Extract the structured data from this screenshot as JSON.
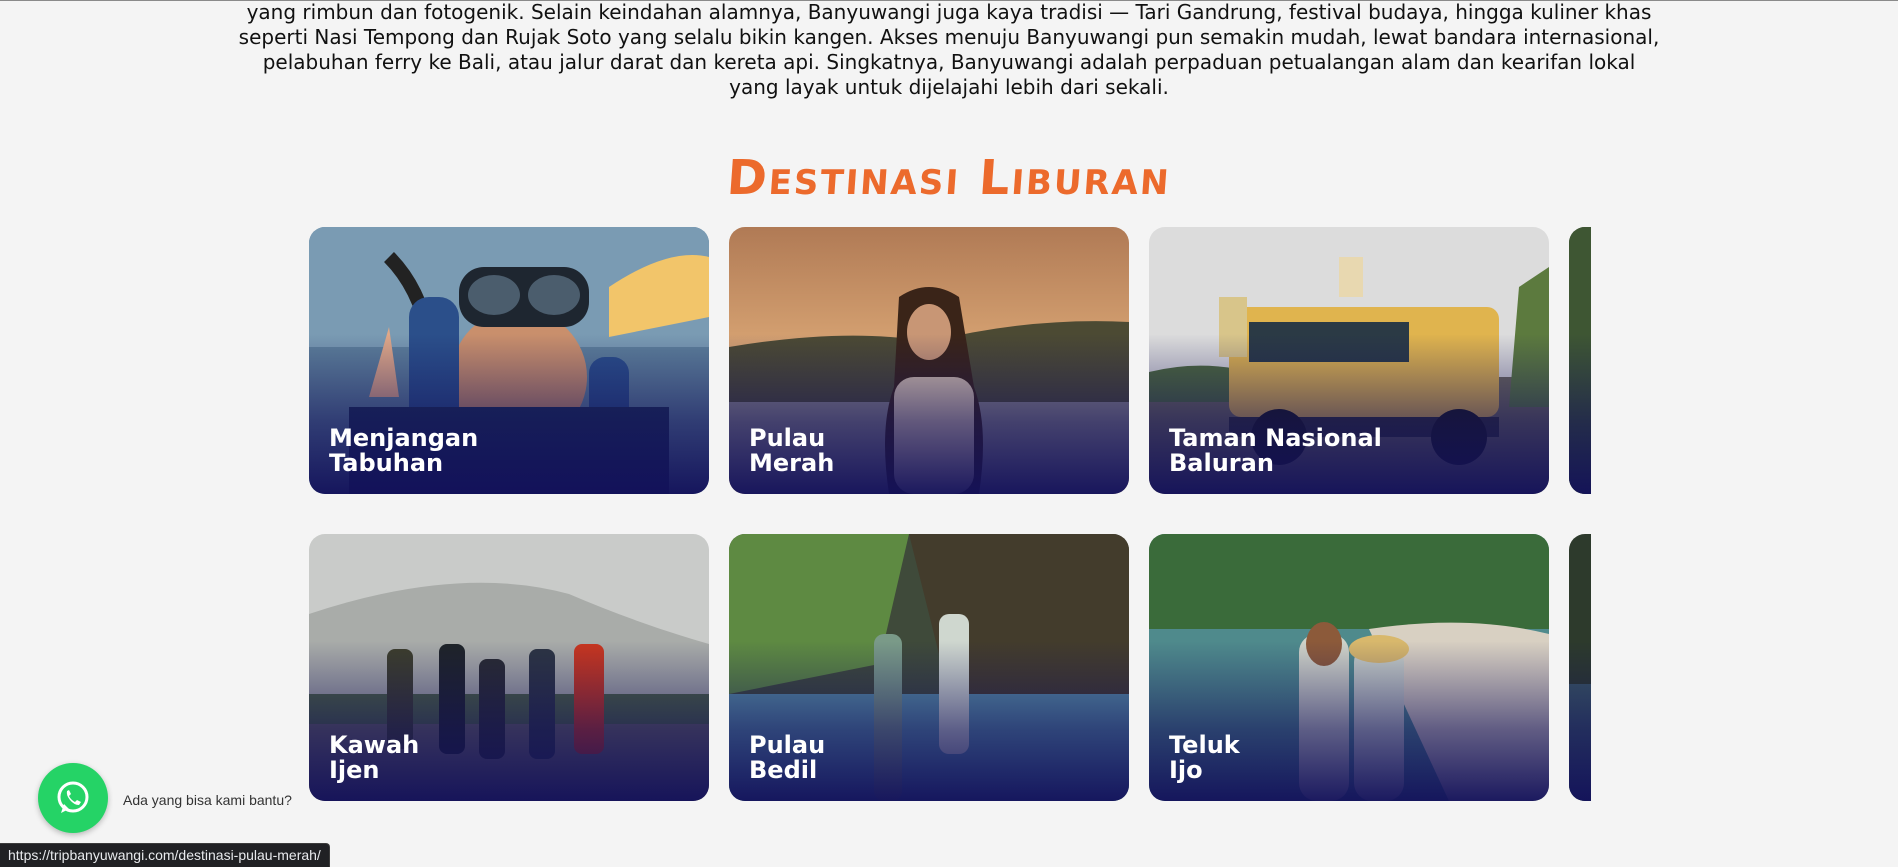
{
  "intro": {
    "lines": [
      "yang rimbun dan fotogenik. Selain keindahan alamnya, Banyuwangi juga kaya tradisi — Tari Gandrung, festival budaya, hingga kuliner khas",
      "seperti Nasi Tempong dan Rujak Soto yang selalu bikin kangen. Akses menuju Banyuwangi pun semakin mudah, lewat bandara internasional,",
      "pelabuhan ferry ke Bali, atau jalur darat dan kereta api. Singkatnya, Banyuwangi adalah perpaduan petualangan alam dan kearifan lokal",
      "yang layak untuk dijelajahi lebih dari sekali."
    ]
  },
  "section": {
    "title": "Destinasi Liburan"
  },
  "destinations": [
    {
      "line1": "Menjangan",
      "line2": "Tabuhan"
    },
    {
      "line1": "Pulau",
      "line2": "Merah"
    },
    {
      "line1": "Taman Nasional",
      "line2": "Baluran"
    },
    {
      "line1": "",
      "line2": ""
    },
    {
      "line1": "Kawah",
      "line2": "Ijen"
    },
    {
      "line1": "Pulau",
      "line2": "Bedil"
    },
    {
      "line1": "Teluk",
      "line2": "Ijo"
    },
    {
      "line1": "",
      "line2": ""
    }
  ],
  "whatsapp": {
    "tooltip": "Ada yang bisa kami bantu?",
    "icon": "whatsapp-icon",
    "color": "#25d366"
  },
  "status_bar": {
    "url": "https://tripbanyuwangi.com/destinasi-pulau-merah/"
  },
  "colors": {
    "heading": "#ec6a2c",
    "background": "#f4f4f4",
    "card_overlay": "#12105a"
  }
}
